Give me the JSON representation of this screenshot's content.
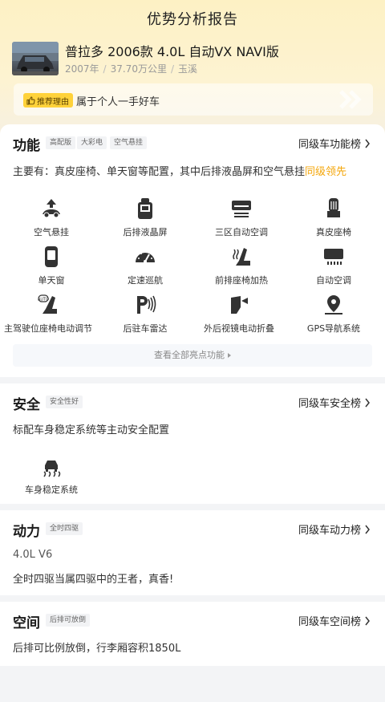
{
  "header": {
    "title": "优势分析报告"
  },
  "car": {
    "name": "普拉多 2006款 4.0L 自动VX NAVI版",
    "year": "2007年",
    "mileage": "37.70万公里",
    "city": "玉溪",
    "separator": "/"
  },
  "reason": {
    "tag": "推荐理由",
    "text": "属于个人一手好车"
  },
  "features": {
    "title": "功能",
    "tags": [
      "高配版",
      "大彩电",
      "空气悬挂"
    ],
    "rank_link": "同级车功能榜",
    "desc_prefix": "主要有：真皮座椅、单天窗等配置，其中后排液晶屏和空气悬挂",
    "desc_highlight": "同级领先",
    "items": [
      {
        "label": "空气悬挂",
        "icon": "air-suspension-icon"
      },
      {
        "label": "后排液晶屏",
        "icon": "rear-screen-icon"
      },
      {
        "label": "三区自动空调",
        "icon": "tri-zone-ac-icon"
      },
      {
        "label": "真皮座椅",
        "icon": "leather-seat-icon"
      },
      {
        "label": "单天窗",
        "icon": "sunroof-icon"
      },
      {
        "label": "定速巡航",
        "icon": "cruise-control-icon"
      },
      {
        "label": "前排座椅加热",
        "icon": "seat-heating-icon"
      },
      {
        "label": "自动空调",
        "icon": "auto-ac-icon"
      },
      {
        "label": "主驾驶位座椅电动调节",
        "icon": "power-seat-icon"
      },
      {
        "label": "后驻车雷达",
        "icon": "parking-radar-icon"
      },
      {
        "label": "外后视镜电动折叠",
        "icon": "mirror-fold-icon"
      },
      {
        "label": "GPS导航系统",
        "icon": "gps-nav-icon"
      }
    ],
    "all_button": "查看全部亮点功能"
  },
  "safety": {
    "title": "安全",
    "tag": "安全性好",
    "rank_link": "同级车安全榜",
    "desc": "标配车身稳定系统等主动安全配置",
    "items": [
      {
        "label": "车身稳定系统",
        "icon": "stability-control-icon"
      }
    ]
  },
  "power": {
    "title": "动力",
    "tag": "全时四驱",
    "rank_link": "同级车动力榜",
    "engine": "4.0L V6",
    "desc": "全时四驱当属四驱中的王者，真香!"
  },
  "space": {
    "title": "空间",
    "tag": "后排可放倒",
    "rank_link": "同级车空间榜",
    "desc": "后排可比例放倒，行李厢容积1850L"
  },
  "colors": {
    "accent": "#f4a60a",
    "tag_yellow": "#ffd23a",
    "header_bg": "#fdf1c4"
  }
}
